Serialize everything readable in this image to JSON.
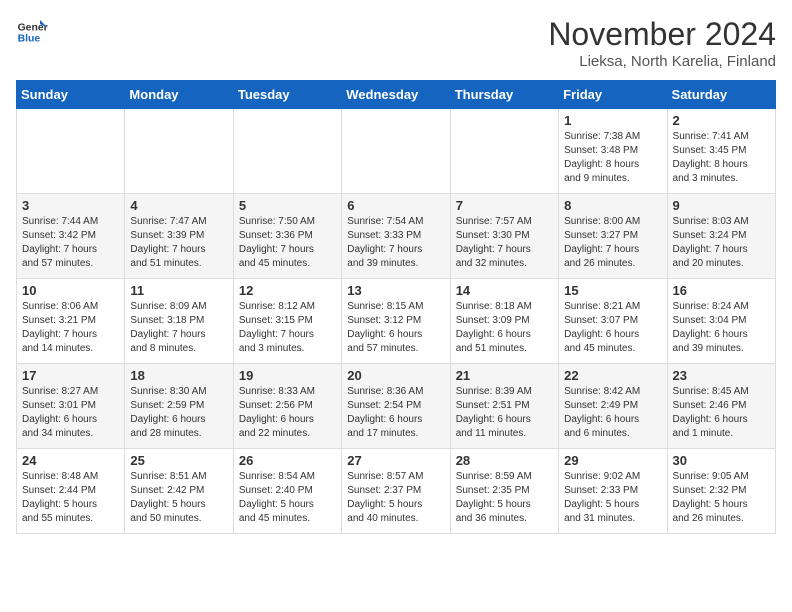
{
  "logo": {
    "general": "General",
    "blue": "Blue"
  },
  "title": "November 2024",
  "location": "Lieksa, North Karelia, Finland",
  "days_of_week": [
    "Sunday",
    "Monday",
    "Tuesday",
    "Wednesday",
    "Thursday",
    "Friday",
    "Saturday"
  ],
  "weeks": [
    [
      {
        "day": "",
        "info": ""
      },
      {
        "day": "",
        "info": ""
      },
      {
        "day": "",
        "info": ""
      },
      {
        "day": "",
        "info": ""
      },
      {
        "day": "",
        "info": ""
      },
      {
        "day": "1",
        "info": "Sunrise: 7:38 AM\nSunset: 3:48 PM\nDaylight: 8 hours\nand 9 minutes."
      },
      {
        "day": "2",
        "info": "Sunrise: 7:41 AM\nSunset: 3:45 PM\nDaylight: 8 hours\nand 3 minutes."
      }
    ],
    [
      {
        "day": "3",
        "info": "Sunrise: 7:44 AM\nSunset: 3:42 PM\nDaylight: 7 hours\nand 57 minutes."
      },
      {
        "day": "4",
        "info": "Sunrise: 7:47 AM\nSunset: 3:39 PM\nDaylight: 7 hours\nand 51 minutes."
      },
      {
        "day": "5",
        "info": "Sunrise: 7:50 AM\nSunset: 3:36 PM\nDaylight: 7 hours\nand 45 minutes."
      },
      {
        "day": "6",
        "info": "Sunrise: 7:54 AM\nSunset: 3:33 PM\nDaylight: 7 hours\nand 39 minutes."
      },
      {
        "day": "7",
        "info": "Sunrise: 7:57 AM\nSunset: 3:30 PM\nDaylight: 7 hours\nand 32 minutes."
      },
      {
        "day": "8",
        "info": "Sunrise: 8:00 AM\nSunset: 3:27 PM\nDaylight: 7 hours\nand 26 minutes."
      },
      {
        "day": "9",
        "info": "Sunrise: 8:03 AM\nSunset: 3:24 PM\nDaylight: 7 hours\nand 20 minutes."
      }
    ],
    [
      {
        "day": "10",
        "info": "Sunrise: 8:06 AM\nSunset: 3:21 PM\nDaylight: 7 hours\nand 14 minutes."
      },
      {
        "day": "11",
        "info": "Sunrise: 8:09 AM\nSunset: 3:18 PM\nDaylight: 7 hours\nand 8 minutes."
      },
      {
        "day": "12",
        "info": "Sunrise: 8:12 AM\nSunset: 3:15 PM\nDaylight: 7 hours\nand 3 minutes."
      },
      {
        "day": "13",
        "info": "Sunrise: 8:15 AM\nSunset: 3:12 PM\nDaylight: 6 hours\nand 57 minutes."
      },
      {
        "day": "14",
        "info": "Sunrise: 8:18 AM\nSunset: 3:09 PM\nDaylight: 6 hours\nand 51 minutes."
      },
      {
        "day": "15",
        "info": "Sunrise: 8:21 AM\nSunset: 3:07 PM\nDaylight: 6 hours\nand 45 minutes."
      },
      {
        "day": "16",
        "info": "Sunrise: 8:24 AM\nSunset: 3:04 PM\nDaylight: 6 hours\nand 39 minutes."
      }
    ],
    [
      {
        "day": "17",
        "info": "Sunrise: 8:27 AM\nSunset: 3:01 PM\nDaylight: 6 hours\nand 34 minutes."
      },
      {
        "day": "18",
        "info": "Sunrise: 8:30 AM\nSunset: 2:59 PM\nDaylight: 6 hours\nand 28 minutes."
      },
      {
        "day": "19",
        "info": "Sunrise: 8:33 AM\nSunset: 2:56 PM\nDaylight: 6 hours\nand 22 minutes."
      },
      {
        "day": "20",
        "info": "Sunrise: 8:36 AM\nSunset: 2:54 PM\nDaylight: 6 hours\nand 17 minutes."
      },
      {
        "day": "21",
        "info": "Sunrise: 8:39 AM\nSunset: 2:51 PM\nDaylight: 6 hours\nand 11 minutes."
      },
      {
        "day": "22",
        "info": "Sunrise: 8:42 AM\nSunset: 2:49 PM\nDaylight: 6 hours\nand 6 minutes."
      },
      {
        "day": "23",
        "info": "Sunrise: 8:45 AM\nSunset: 2:46 PM\nDaylight: 6 hours\nand 1 minute."
      }
    ],
    [
      {
        "day": "24",
        "info": "Sunrise: 8:48 AM\nSunset: 2:44 PM\nDaylight: 5 hours\nand 55 minutes."
      },
      {
        "day": "25",
        "info": "Sunrise: 8:51 AM\nSunset: 2:42 PM\nDaylight: 5 hours\nand 50 minutes."
      },
      {
        "day": "26",
        "info": "Sunrise: 8:54 AM\nSunset: 2:40 PM\nDaylight: 5 hours\nand 45 minutes."
      },
      {
        "day": "27",
        "info": "Sunrise: 8:57 AM\nSunset: 2:37 PM\nDaylight: 5 hours\nand 40 minutes."
      },
      {
        "day": "28",
        "info": "Sunrise: 8:59 AM\nSunset: 2:35 PM\nDaylight: 5 hours\nand 36 minutes."
      },
      {
        "day": "29",
        "info": "Sunrise: 9:02 AM\nSunset: 2:33 PM\nDaylight: 5 hours\nand 31 minutes."
      },
      {
        "day": "30",
        "info": "Sunrise: 9:05 AM\nSunset: 2:32 PM\nDaylight: 5 hours\nand 26 minutes."
      }
    ]
  ]
}
